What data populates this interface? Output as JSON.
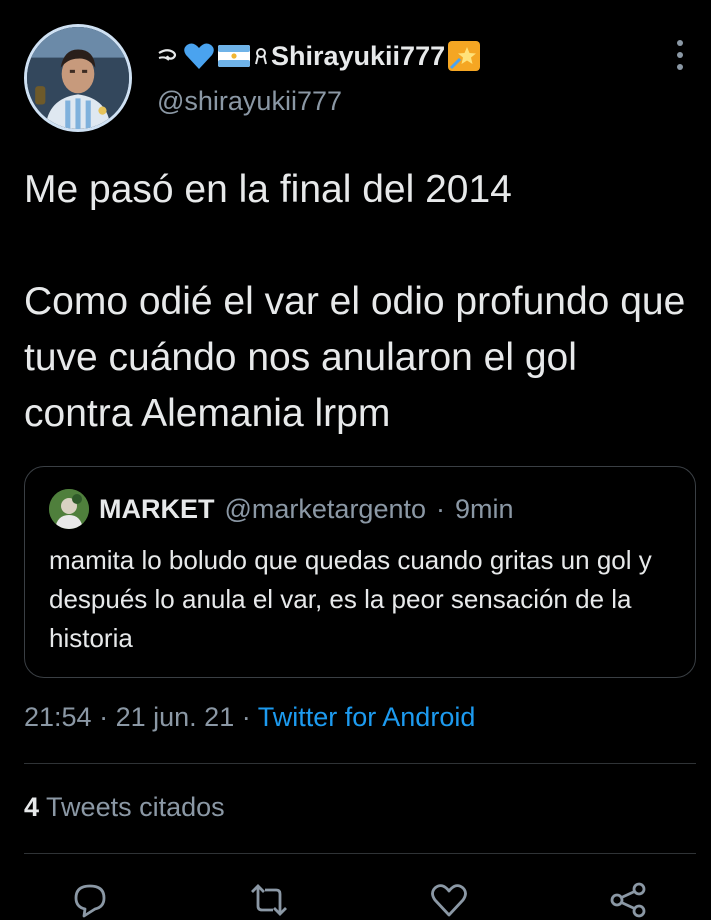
{
  "author": {
    "display_name": "Shirayukii777",
    "handle": "@shirayukii777",
    "emoji_prefix": [
      "wind-icon",
      "blue-heart-icon",
      "argentina-flag-icon",
      "ribbon-icon"
    ],
    "emoji_suffix": "shooting-star-icon"
  },
  "tweet": {
    "line1": "Me pasó en la final del 2014",
    "line2": "Como odié el var el odio profundo que tuve cuándo nos anularon el gol contra Alemania lrpm"
  },
  "quoted_tweet": {
    "name": "MARKET",
    "handle": "@marketargento",
    "separator": "·",
    "time": "9min",
    "text": "mamita lo boludo que quedas cuando gritas un gol y después lo anula el var, es la peor sensación de la historia"
  },
  "meta": {
    "time": "21:54",
    "sep1": "·",
    "date": "21 jun. 21",
    "sep2": "·",
    "source": "Twitter for Android"
  },
  "stats": {
    "quote_count": "4",
    "quote_label": "Tweets citados"
  },
  "actions": [
    "reply-icon",
    "retweet-icon",
    "like-icon",
    "share-icon"
  ],
  "colors": {
    "background": "#000000",
    "text": "#e7e9ea",
    "secondary": "#8b98a5",
    "link": "#1d9bf0",
    "border": "#2f3336"
  }
}
